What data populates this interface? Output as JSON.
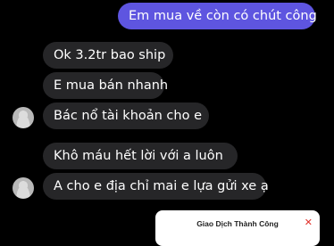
{
  "messages": {
    "sent_1": "Em mua về còn có chút công",
    "recv_1": "Ok 3.2tr bao ship",
    "recv_2": "E mua bán nhanh",
    "recv_3": "Bác nổ tài khoản cho e",
    "recv_4": "Khô máu hết lời với a luôn",
    "recv_5": "A cho e địa chỉ mai e lựa gửi xe ạ"
  },
  "transfer_card": {
    "title": "Giao Dịch Thành Công",
    "close_glyph": "✕"
  },
  "colors": {
    "sent_bubble": "#5e55e0",
    "received_bubble": "#262628",
    "background": "#000000"
  }
}
